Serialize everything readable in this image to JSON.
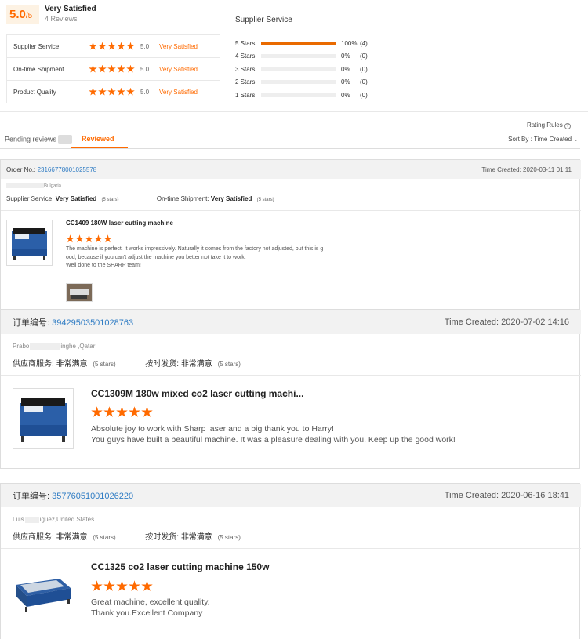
{
  "summary": {
    "score": "5.0",
    "denom": "/5",
    "title": "Very Satisfied",
    "reviews": "4 Reviews",
    "dsr": [
      {
        "label": "Supplier Service",
        "stars": 5,
        "score": "5.0",
        "rating": "Very Satisfied"
      },
      {
        "label": "On-time Shipment",
        "stars": 5,
        "score": "5.0",
        "rating": "Very Satisfied"
      },
      {
        "label": "Product Quality",
        "stars": 5,
        "score": "5.0",
        "rating": "Very Satisfied"
      }
    ],
    "distribution_title": "Supplier Service",
    "distribution": [
      {
        "label": "5 Stars",
        "fraction": 1.0,
        "pct": "100%",
        "count": "(4)"
      },
      {
        "label": "4 Stars",
        "fraction": 0,
        "pct": "0%",
        "count": "(0)"
      },
      {
        "label": "3 Stars",
        "fraction": 0,
        "pct": "0%",
        "count": "(0)"
      },
      {
        "label": "2 Stars",
        "fraction": 0,
        "pct": "0%",
        "count": "(0)"
      },
      {
        "label": "1 Stars",
        "fraction": 0,
        "pct": "0%",
        "count": "(0)"
      }
    ]
  },
  "toolbar": {
    "rating_rules": "Rating Rules",
    "sort_by": "Sort By : Time Created"
  },
  "tabs": {
    "pending": "Pending reviews",
    "reviewed": "Reviewed"
  },
  "reviews": [
    {
      "order_label": "Order No.:",
      "order_no": "23166778001025578",
      "time": "Time Created: 2020-03-11 01:11",
      "buyer": "Bulgaria",
      "service_label": "Supplier Service:",
      "service_value": "Very Satisfied",
      "service_stars": "(5 stars)",
      "shipment_label": "On-time Shipment:",
      "shipment_value": "Very Satisfied",
      "shipment_stars": "(5 stars)",
      "product_title": "CC1409 180W laser cutting machine",
      "stars": 5,
      "text_lines": [
        "The machine is perfect. It works impressively. Naturally it comes from the factory not adjusted, but this is g",
        "ood, because if you can't adjust the machine you better not take it to work.",
        "Well done to the SHARP team!"
      ]
    },
    {
      "order_label": "订单编号:",
      "order_no": "39429503501028763",
      "time": "Time Created: 2020-07-02 14:16",
      "buyer_pre": "Prabo",
      "buyer": "inghe ,Qatar",
      "service_label": "供应商服务:",
      "service_value": "非常满意",
      "service_stars": "(5 stars)",
      "shipment_label": "按时发货:",
      "shipment_value": "非常满意",
      "shipment_stars": "(5 stars)",
      "product_title": "CC1309M 180w mixed co2 laser cutting machi...",
      "stars": 5,
      "text_lines": [
        "Absolute joy to work with Sharp laser and a big thank you to Harry!",
        "You guys have built a beautiful machine. It was a pleasure dealing with you. Keep up the good work!"
      ]
    },
    {
      "order_label": "订单编号:",
      "order_no": "35776051001026220",
      "time": "Time Created: 2020-06-16 18:41",
      "buyer_pre": "Luis",
      "buyer": "iguez,United States",
      "service_label": "供应商服务:",
      "service_value": "非常满意",
      "service_stars": "(5 stars)",
      "shipment_label": "按时发货:",
      "shipment_value": "非常满意",
      "shipment_stars": "(5 stars)",
      "product_title": "CC1325 co2 laser cutting machine 150w",
      "stars": 5,
      "text_lines": [
        "Great machine, excellent quality.",
        "Thank you.Excellent Company"
      ]
    }
  ],
  "colors": {
    "accent": "#ff6a00",
    "link": "#2f7cc4",
    "order_bar": "#f2f2f2"
  }
}
